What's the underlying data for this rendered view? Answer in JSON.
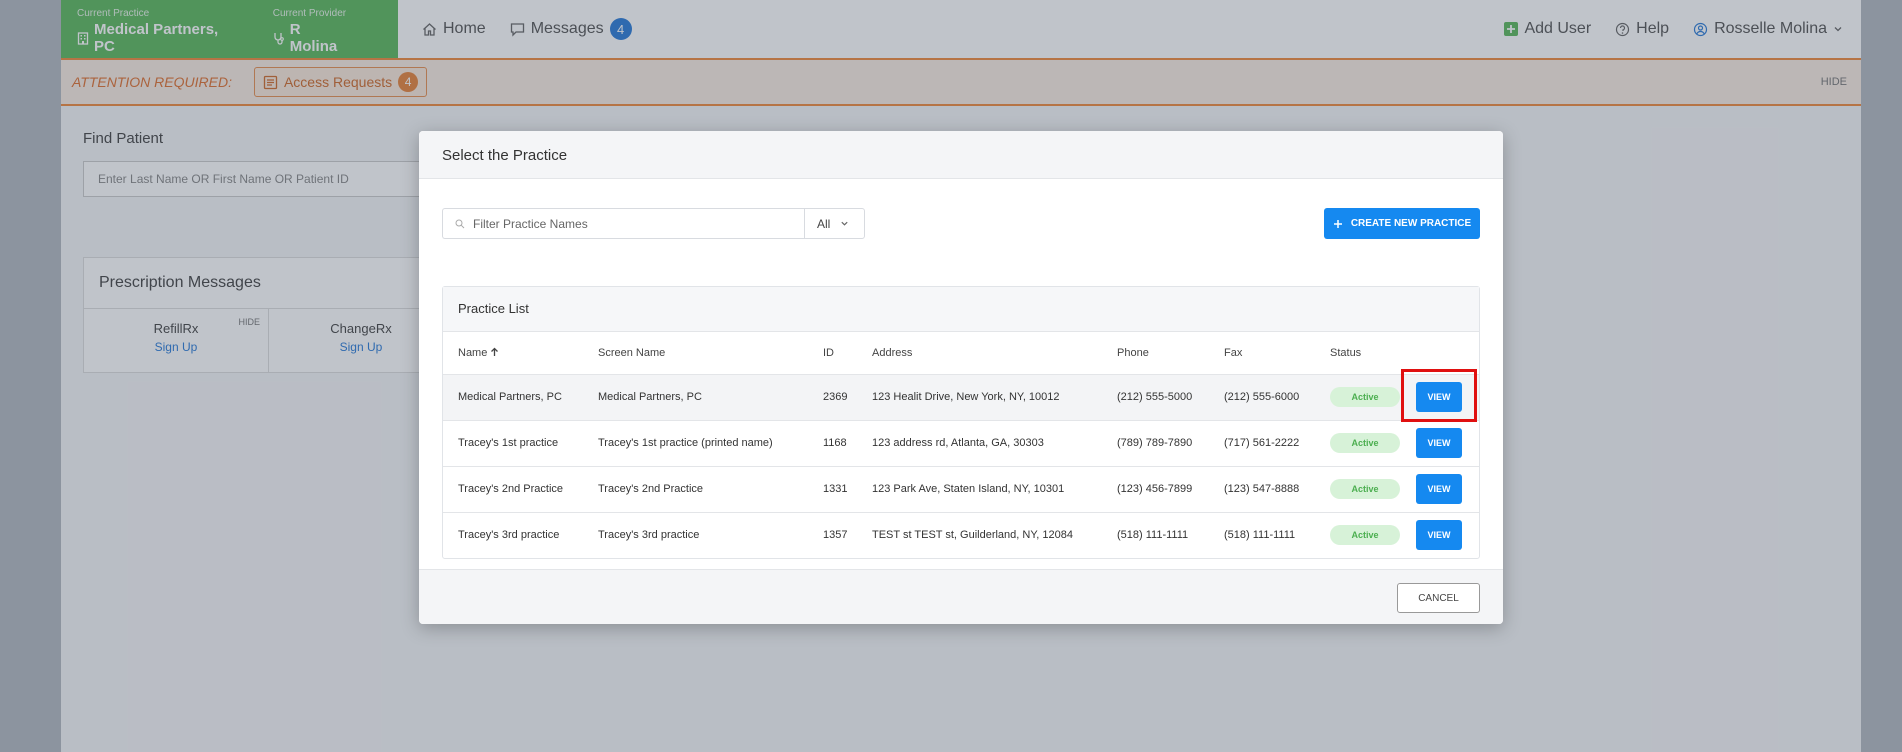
{
  "topnav": {
    "current_practice_label": "Current Practice",
    "current_practice": "Medical Partners, PC",
    "current_provider_label": "Current Provider",
    "current_provider": "R Molina",
    "home": "Home",
    "messages": "Messages",
    "messages_count": "4",
    "add_user": "Add User",
    "help": "Help",
    "user_name": "Rosselle Molina"
  },
  "attention": {
    "label": "ATTENTION REQUIRED:",
    "access_requests": "Access Requests",
    "access_requests_count": "4",
    "hide": "HIDE"
  },
  "background": {
    "find_patient_title": "Find Patient",
    "find_patient_placeholder": "Enter Last Name OR First Name OR Patient ID",
    "prescription_title": "Prescription Messages",
    "refillrx": "RefillRx",
    "changerx": "ChangeRx",
    "sign_up": "Sign Up",
    "hide": "HIDE"
  },
  "modal": {
    "title": "Select the Practice",
    "filter_placeholder": "Filter Practice Names",
    "filter_select": "All",
    "create_button": "CREATE NEW PRACTICE",
    "list_title": "Practice List",
    "columns": {
      "name": "Name",
      "screen_name": "Screen Name",
      "id": "ID",
      "address": "Address",
      "phone": "Phone",
      "fax": "Fax",
      "status": "Status"
    },
    "rows": [
      {
        "name": "Medical Partners, PC",
        "screen_name": "Medical Partners, PC",
        "id": "2369",
        "address": "123 Healit Drive, New York, NY, 10012",
        "phone": "(212) 555-5000",
        "fax": "(212) 555-6000",
        "status": "Active",
        "action": "VIEW"
      },
      {
        "name": "Tracey's 1st practice",
        "screen_name": "Tracey's 1st practice (printed name)",
        "id": "1168",
        "address": "123 address rd, Atlanta, GA, 30303",
        "phone": "(789) 789-7890",
        "fax": "(717) 561-2222",
        "status": "Active",
        "action": "VIEW"
      },
      {
        "name": "Tracey's 2nd Practice",
        "screen_name": "Tracey's 2nd Practice",
        "id": "1331",
        "address": "123 Park Ave, Staten Island, NY, 10301",
        "phone": "(123) 456-7899",
        "fax": "(123) 547-8888",
        "status": "Active",
        "action": "VIEW"
      },
      {
        "name": "Tracey's 3rd practice",
        "screen_name": "Tracey's 3rd practice",
        "id": "1357",
        "address": "TEST st TEST st, Guilderland, NY, 12084",
        "phone": "(518) 111-1111",
        "fax": "(518) 111-1111",
        "status": "Active",
        "action": "VIEW"
      }
    ],
    "cancel": "CANCEL"
  },
  "colors": {
    "practice_green": "#5cb85c",
    "accent_orange": "#f08a3c",
    "primary_blue": "#1589f0",
    "highlight_red": "#e01010"
  }
}
